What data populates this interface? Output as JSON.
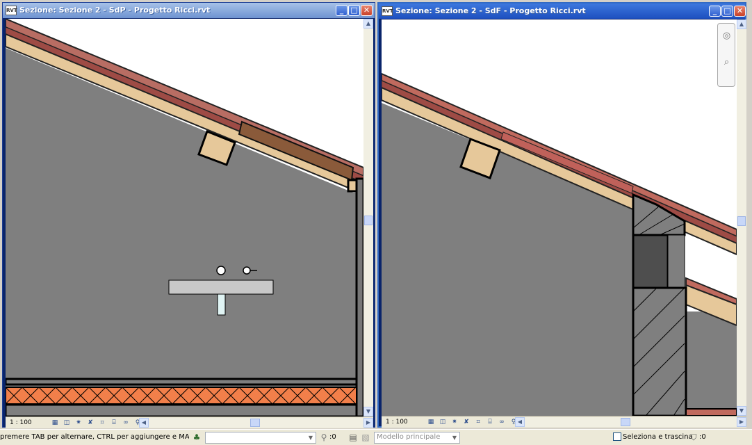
{
  "windows": [
    {
      "title": "Sezione: Sezione 2 - SdP - Progetto Ricci.rvt",
      "app_icon": "RVT",
      "scale": "1 : 100",
      "buttons": {
        "minimize": "_",
        "maximize": "□",
        "close": "✕"
      }
    },
    {
      "title": "Sezione: Sezione 2 - SdF - Progetto Ricci.rvt",
      "app_icon": "RVT",
      "scale": "1 : 100",
      "buttons": {
        "minimize": "_",
        "maximize": "□",
        "close": "✕"
      }
    }
  ],
  "view_control_icons": [
    "detail-level-icon",
    "visual-style-icon",
    "sun-path-icon",
    "shadows-icon",
    "crop-region-icon",
    "show-crop-icon",
    "temporary-hide-icon",
    "reveal-hidden-icon"
  ],
  "colors": {
    "cut_wall": "#7f7f7f",
    "roof_wood": "#e4c79a",
    "roof_red": "#c06a5e",
    "insulation_orange": "#f27f4a",
    "title_active": "#1d4fbf"
  },
  "statusbar": {
    "message": "premere TAB per alternare, CTRL per aggiungere e MAIUSC per deselezi",
    "select_count": ":0",
    "model_placeholder": "Modello principale",
    "drag_option": "Seleziona e trascina",
    "filter_count": ":0"
  }
}
